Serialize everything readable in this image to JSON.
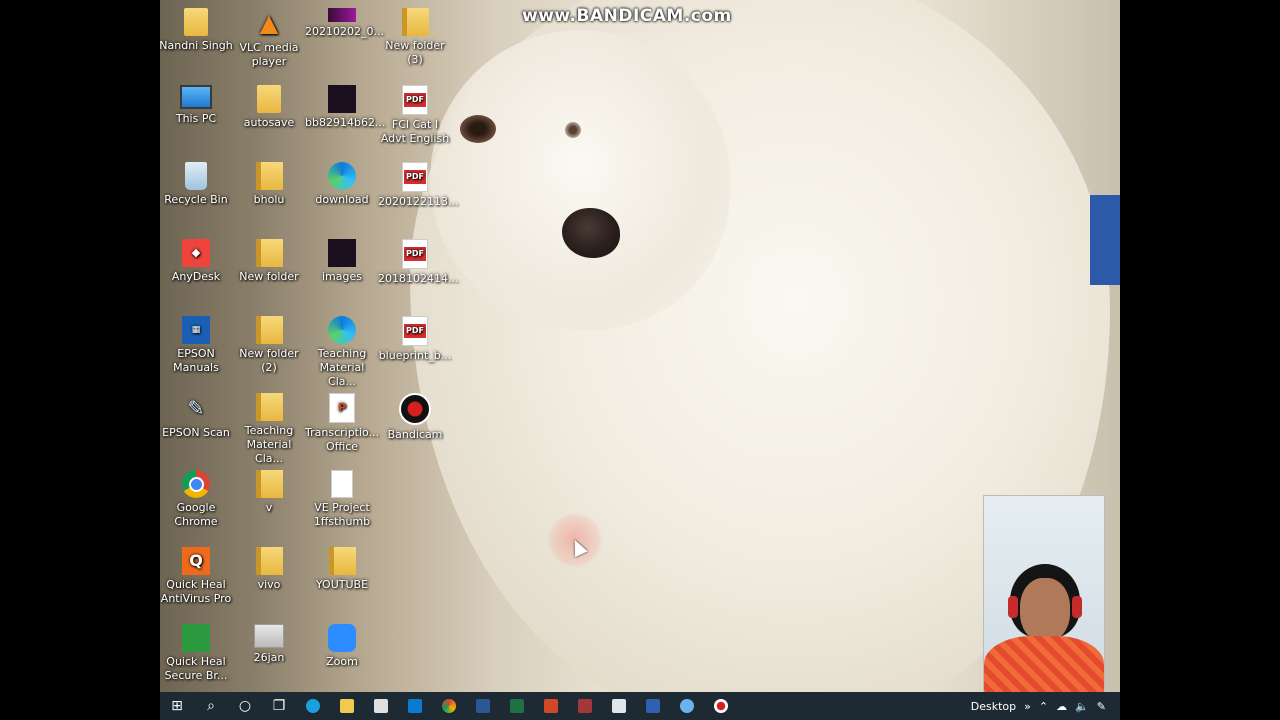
{
  "watermark": "www.BANDICAM.com",
  "desktop_icons": [
    {
      "label": "Nandni Singh",
      "icon": "user-folder-icon"
    },
    {
      "label": "VLC media player",
      "icon": "vlc-icon"
    },
    {
      "label": "20210202_0...",
      "icon": "video-thumb-icon"
    },
    {
      "label": "New folder (3)",
      "icon": "folder-icon"
    },
    {
      "label": "This PC",
      "icon": "computer-icon"
    },
    {
      "label": "autosave",
      "icon": "folder-icon"
    },
    {
      "label": "bb82914b62...",
      "icon": "image-file-icon"
    },
    {
      "label": "FCI Cat I Advt English",
      "icon": "pdf-icon"
    },
    {
      "label": "Recycle Bin",
      "icon": "recycle-bin-icon"
    },
    {
      "label": "bholu",
      "icon": "folder-icon"
    },
    {
      "label": "download",
      "icon": "edge-icon"
    },
    {
      "label": "2020122113...",
      "icon": "pdf-icon"
    },
    {
      "label": "AnyDesk",
      "icon": "anydesk-icon"
    },
    {
      "label": "New folder",
      "icon": "folder-icon"
    },
    {
      "label": "images",
      "icon": "image-file-icon"
    },
    {
      "label": "2018102414...",
      "icon": "pdf-icon"
    },
    {
      "label": "EPSON Manuals",
      "icon": "epson-manuals-icon"
    },
    {
      "label": "New folder (2)",
      "icon": "folder-icon"
    },
    {
      "label": "Teaching Material Cla...",
      "icon": "edge-icon"
    },
    {
      "label": "blueprint_b...",
      "icon": "pdf-icon"
    },
    {
      "label": "EPSON Scan",
      "icon": "epson-scan-icon"
    },
    {
      "label": "Teaching Material Cla...",
      "icon": "folder-icon"
    },
    {
      "label": "Transcriptio... Office",
      "icon": "powerpoint-file-icon"
    },
    {
      "label": "Bandicam",
      "icon": "bandicam-icon"
    },
    {
      "label": "Google Chrome",
      "icon": "chrome-icon"
    },
    {
      "label": "v",
      "icon": "folder-icon"
    },
    {
      "label": "VE Project 1ffsthumb",
      "icon": "blank-file-icon"
    },
    {
      "label": "Quick Heal AntiVirus Pro",
      "icon": "quickheal-icon"
    },
    {
      "label": "vivo",
      "icon": "folder-icon"
    },
    {
      "label": "YOUTUBE",
      "icon": "folder-icon"
    },
    {
      "label": "Quick Heal Secure Br...",
      "icon": "quickheal-browser-icon"
    },
    {
      "label": "26jan",
      "icon": "image-file-icon"
    },
    {
      "label": "Zoom",
      "icon": "zoom-icon"
    }
  ],
  "taskbar": {
    "desktop_label": "Desktop",
    "apps": [
      "start",
      "search",
      "cortana",
      "task-view",
      "edge",
      "file-explorer",
      "store",
      "mail",
      "chrome",
      "word",
      "excel",
      "powerpoint",
      "access",
      "app-window",
      "app-k",
      "app-w",
      "bandicam"
    ]
  }
}
